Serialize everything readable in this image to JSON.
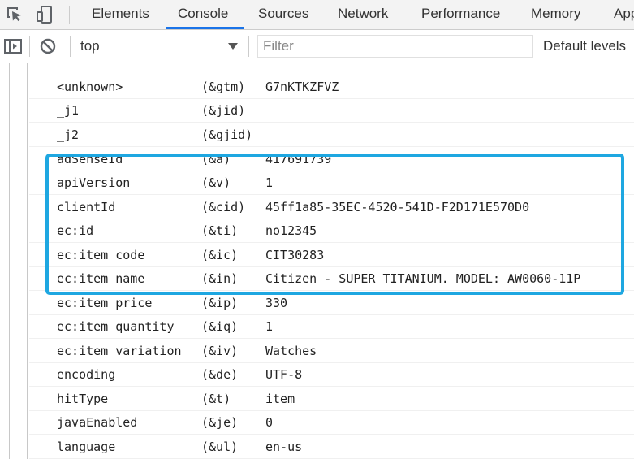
{
  "tabs": [
    {
      "label": "Elements"
    },
    {
      "label": "Console"
    },
    {
      "label": "Sources"
    },
    {
      "label": "Network"
    },
    {
      "label": "Performance"
    },
    {
      "label": "Memory"
    },
    {
      "label": "App"
    }
  ],
  "toolbar": {
    "context": "top",
    "filter_placeholder": "Filter",
    "levels": "Default levels"
  },
  "rows": [
    {
      "name": "<unknown>",
      "param": "(&gtm)",
      "value": "G7nKTKZFVZ"
    },
    {
      "name": "_j1",
      "param": "(&jid)",
      "value": ""
    },
    {
      "name": "_j2",
      "param": "(&gjid)",
      "value": ""
    },
    {
      "name": "adSenseId",
      "param": "(&a)",
      "value": "417691739"
    },
    {
      "name": "apiVersion",
      "param": "(&v)",
      "value": "1"
    },
    {
      "name": "clientId",
      "param": "(&cid)",
      "value": "45ff1a85-35EC-4520-541D-F2D171E570D0"
    },
    {
      "name": "ec:id",
      "param": "(&ti)",
      "value": "no12345"
    },
    {
      "name": "ec:item code",
      "param": "(&ic)",
      "value": "CIT30283"
    },
    {
      "name": "ec:item name",
      "param": "(&in)",
      "value": "Citizen - SUPER TITANIUM. MODEL: AW0060-11P"
    },
    {
      "name": "ec:item price",
      "param": "(&ip)",
      "value": "330"
    },
    {
      "name": "ec:item quantity",
      "param": "(&iq)",
      "value": "1"
    },
    {
      "name": "ec:item variation",
      "param": "(&iv)",
      "value": "Watches"
    },
    {
      "name": "encoding",
      "param": "(&de)",
      "value": "UTF-8"
    },
    {
      "name": "hitType",
      "param": "(&t)",
      "value": "item"
    },
    {
      "name": "javaEnabled",
      "param": "(&je)",
      "value": "0"
    },
    {
      "name": "language",
      "param": "(&ul)",
      "value": "en-us"
    }
  ],
  "icons": {
    "inspect": "inspect-element-icon",
    "device": "device-toolbar-icon",
    "sidebar": "show-sidebar-icon",
    "clear": "clear-console-icon",
    "dropdown": "chevron-down-icon"
  },
  "colors": {
    "highlight": "#1ea7e1",
    "active_tab": "#1a73e8"
  }
}
